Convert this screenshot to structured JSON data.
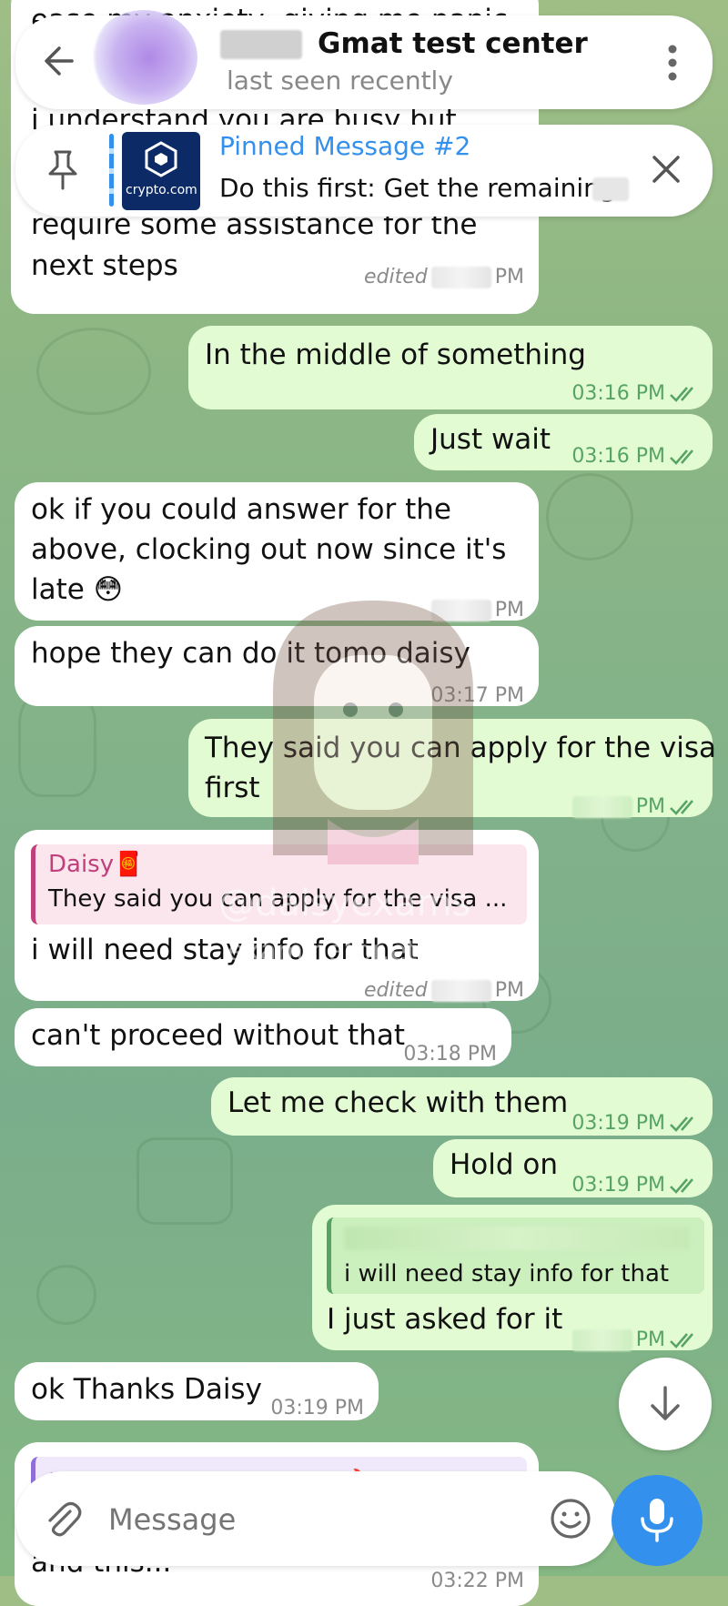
{
  "header": {
    "name": "Gmat test center",
    "status": "last seen recently"
  },
  "pinned": {
    "title": "Pinned Message #2",
    "text": "Do this first: Get the remaining",
    "thumb_label": "crypto.com"
  },
  "messages": [
    {
      "id": "m1",
      "dir": "in",
      "lines": [
        "ease my anxiety, giving me panic",
        "i understand you are busy but",
        "require some assistance for the",
        "next steps"
      ],
      "time": "PM",
      "edited": "edited"
    },
    {
      "id": "m2",
      "dir": "out",
      "lines": [
        "In the middle of something"
      ],
      "time": "03:16 PM"
    },
    {
      "id": "m3",
      "dir": "out",
      "lines": [
        "Just wait"
      ],
      "time": "03:16 PM"
    },
    {
      "id": "m4",
      "dir": "in",
      "lines": [
        "ok if you could answer for the",
        "above, clocking out now since it's",
        "late 😳"
      ],
      "time": "PM"
    },
    {
      "id": "m5",
      "dir": "in",
      "lines": [
        "hope they can do it tomo daisy"
      ],
      "time": "03:17 PM"
    },
    {
      "id": "m6",
      "dir": "out",
      "lines": [
        "They said you can apply for the visa",
        "first"
      ],
      "time": "PM"
    },
    {
      "id": "m7",
      "dir": "in",
      "reply_name": "Daisy🧧",
      "reply_text": "They said you can apply for the visa ...",
      "lines": [
        "i will need stay info for that"
      ],
      "time": "PM",
      "edited": "edited"
    },
    {
      "id": "m8",
      "dir": "in",
      "lines": [
        "can't proceed without that"
      ],
      "time": "03:18 PM"
    },
    {
      "id": "m9",
      "dir": "out",
      "lines": [
        "Let me check with them"
      ],
      "time": "03:19 PM"
    },
    {
      "id": "m10",
      "dir": "out",
      "lines": [
        "Hold on"
      ],
      "time": "03:19 PM"
    },
    {
      "id": "m11",
      "dir": "out",
      "reply_text": "i will need stay info for that",
      "lines": [
        "I just asked for it"
      ],
      "time": "PM"
    },
    {
      "id": "m12",
      "dir": "in",
      "lines": [
        "ok Thanks Daisy"
      ],
      "time": "03:19 PM"
    },
    {
      "id": "m13",
      "dir": "in",
      "reply_name": "Please Gmat test center 🔥",
      "lines": [
        "and this..."
      ],
      "time": "03:22 PM"
    }
  ],
  "watermark": {
    "handle": "@daisyexams",
    "site": "examinator.eth.limo"
  },
  "input": {
    "placeholder": "Message"
  },
  "icons": {
    "back": "arrow-left",
    "more": "three-dots-vertical",
    "pin": "pushpin",
    "close": "x",
    "attach": "paperclip",
    "emoji": "smiley",
    "mic": "microphone",
    "scroll": "arrow-down",
    "read": "double-check"
  },
  "colors": {
    "accent": "#3390ec",
    "out_bubble": "#e3fbd3",
    "in_bubble": "#ffffff",
    "read_ticks": "#56a463",
    "reply_name": "#c13f7b"
  }
}
